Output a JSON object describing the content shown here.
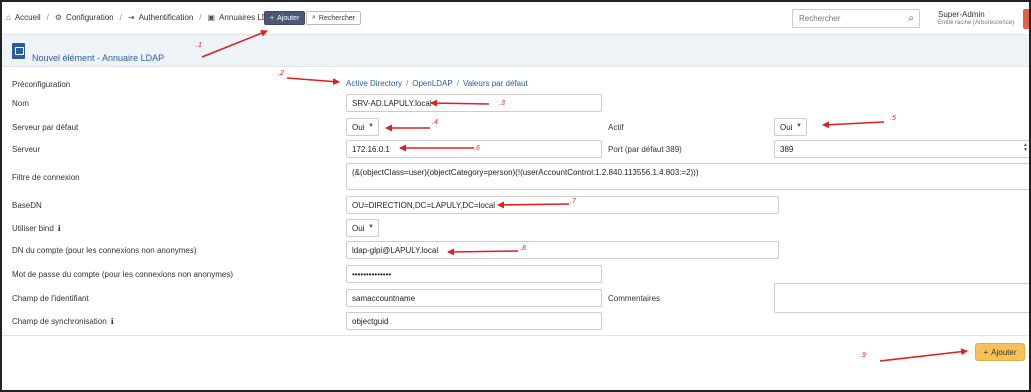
{
  "breadcrumb": {
    "home": "Accueil",
    "config": "Configuration",
    "auth": "Authentification",
    "ldap": "Annuaires LDAP"
  },
  "toolbar": {
    "add_label": "Ajouter",
    "search_label": "Rechercher"
  },
  "search": {
    "placeholder": "Rechercher"
  },
  "user": {
    "name": "Super-Admin",
    "entity": "Entité racine (Arborescence)"
  },
  "header": {
    "title": "Nouvel élément - Annuaire LDAP"
  },
  "form": {
    "preconfig_label": "Préconfiguration",
    "presets": [
      "Active Directory",
      "OpenLDAP",
      "Valeurs par défaut"
    ],
    "name_label": "Nom",
    "name_value": "SRV-AD.LAPULY.local",
    "default_server_label": "Serveur par défaut",
    "default_server_value": "Oui",
    "active_label": "Actif",
    "active_value": "Oui",
    "server_label": "Serveur",
    "server_value": "172.16.0.1",
    "port_label": "Port (par défaut 389)",
    "port_value": "389",
    "filter_label": "Filtre de connexion",
    "filter_value": "(&(objectClass=user)(objectCategory=person)(!(userAccountControl:1.2.840.113556.1.4.803:=2)))",
    "basedn_label": "BaseDN",
    "basedn_value": "OU=DIRECTION,DC=LAPULY,DC=local",
    "bind_label": "Utiliser bind",
    "bind_value": "Oui",
    "account_dn_label": "DN du compte (pour les connexions non anonymes)",
    "account_dn_value": "ldap-glpi@LAPULY.local",
    "password_label": "Mot de passe du compte (pour les connexions non anonymes)",
    "password_value": "••••••••••••••",
    "identifier_label": "Champ de l'identifiant",
    "identifier_value": "samaccountname",
    "comments_label": "Commentaires",
    "sync_label": "Champ de synchronisation",
    "sync_value": "objectguid",
    "submit_label": "Ajouter"
  },
  "annotations": [
    ".1",
    ".2",
    ".3",
    ".4",
    ".5",
    ".6",
    ".7",
    ".8",
    ".9"
  ],
  "colors": {
    "accent": "#2a5d9e",
    "primary_button": "#4a5775",
    "submit_button": "#f5c158",
    "annotation": "#e02020"
  }
}
